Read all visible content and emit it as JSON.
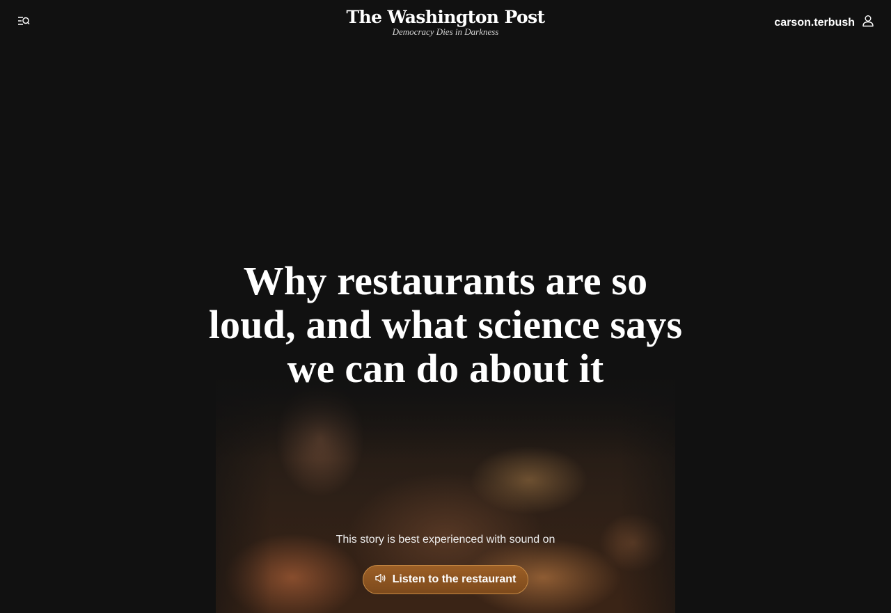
{
  "header": {
    "logo_name": "The Washington Post",
    "logo_tagline": "Democracy Dies in Darkness",
    "username": "carson.terbush",
    "menu_icon": "menu-search-icon",
    "user_icon": "user-icon"
  },
  "article": {
    "headline": "Why restaurants are so loud, and what science says we can do about it",
    "sound_note": "This story is best experienced with sound on",
    "listen_button_label": "Listen to the restaurant",
    "listen_icon": "speaker-icon"
  },
  "colors": {
    "background": "#111111",
    "button_fill": "#8a5320",
    "button_border": "#c68a45",
    "text": "#ffffff"
  }
}
